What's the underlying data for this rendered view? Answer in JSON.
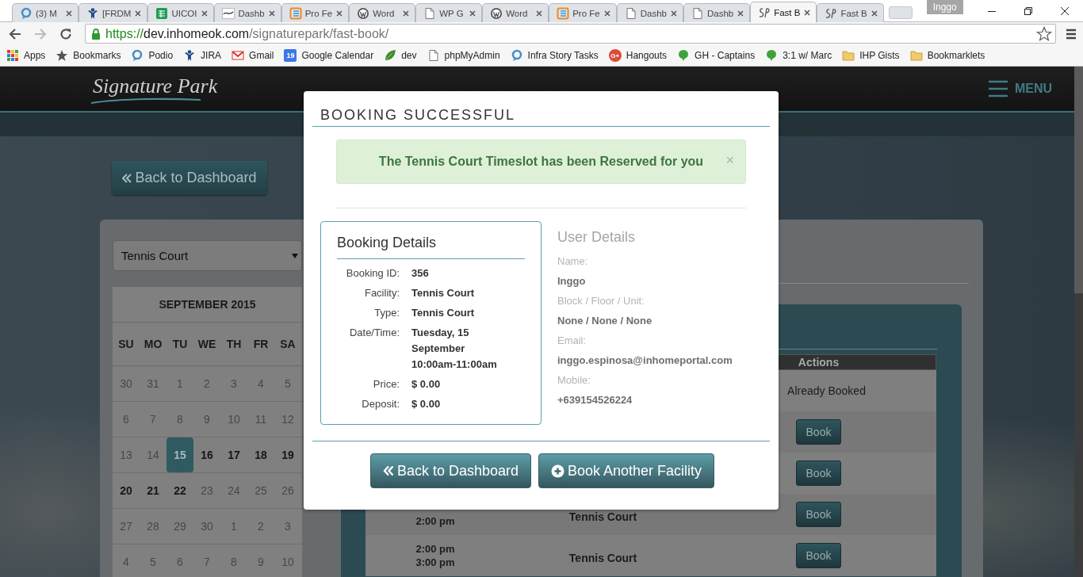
{
  "browser": {
    "tabs": [
      {
        "label": "(3) M",
        "kind": "pin",
        "selected": false
      },
      {
        "label": "[FRDM",
        "kind": "figure",
        "selected": false
      },
      {
        "label": "UICOI",
        "kind": "sheet",
        "selected": false
      },
      {
        "label": "Dashb",
        "kind": "thumb",
        "selected": false
      },
      {
        "label": "Pro Fe",
        "kind": "frame",
        "selected": false
      },
      {
        "label": "Word",
        "kind": "circle",
        "selected": false
      },
      {
        "label": "WP G",
        "kind": "page",
        "selected": false
      },
      {
        "label": "Word",
        "kind": "circle",
        "selected": false
      },
      {
        "label": "Pro Fe",
        "kind": "frame",
        "selected": false
      },
      {
        "label": "Dashb",
        "kind": "page",
        "selected": false
      },
      {
        "label": "Dashb",
        "kind": "page",
        "selected": false
      },
      {
        "label": "Fast B",
        "kind": "script",
        "selected": true
      },
      {
        "label": "Fast B",
        "kind": "script",
        "selected": false
      }
    ],
    "profile": "Inggo",
    "url": {
      "scheme": "https://",
      "host": "dev.inhomeok.com",
      "path": "/signaturepark/fast-book/"
    },
    "bookmarks": [
      {
        "label": "Apps",
        "kind": "grid"
      },
      {
        "label": "Bookmarks",
        "kind": "star"
      },
      {
        "label": "Podio",
        "kind": "pin"
      },
      {
        "label": "JIRA",
        "kind": "figure"
      },
      {
        "label": "Gmail",
        "kind": "mail"
      },
      {
        "label": "Google Calendar",
        "kind": "calendar",
        "badge": "19"
      },
      {
        "label": "dev",
        "kind": "leaf"
      },
      {
        "label": "phpMyAdmin",
        "kind": "page"
      },
      {
        "label": "Infra Story Tasks",
        "kind": "pin"
      },
      {
        "label": "Hangouts",
        "kind": "round",
        "badge": "G+"
      },
      {
        "label": "GH - Captains",
        "kind": "bubble"
      },
      {
        "label": "3:1 w/ Marc",
        "kind": "bubble"
      },
      {
        "label": "IHP Gists",
        "kind": "folder"
      },
      {
        "label": "Bookmarklets",
        "kind": "folder"
      }
    ]
  },
  "header": {
    "logo": "Signature Park",
    "menu": "MENU"
  },
  "back_button": "Back to Dashboard",
  "facility_select": {
    "value": "Tennis Court"
  },
  "calendar": {
    "title": "SEPTEMBER 2015",
    "weekdays": [
      "SU",
      "MO",
      "TU",
      "WE",
      "TH",
      "FR",
      "SA"
    ],
    "weeks": [
      [
        {
          "day": "30",
          "muted": true,
          "selected": false
        },
        {
          "day": "31",
          "muted": true,
          "selected": false
        },
        {
          "day": "1",
          "muted": true,
          "selected": false
        },
        {
          "day": "2",
          "muted": true,
          "selected": false
        },
        {
          "day": "3",
          "muted": true,
          "selected": false
        },
        {
          "day": "4",
          "muted": true,
          "selected": false
        },
        {
          "day": "5",
          "muted": true,
          "selected": false
        }
      ],
      [
        {
          "day": "6",
          "muted": true,
          "selected": false
        },
        {
          "day": "7",
          "muted": true,
          "selected": false
        },
        {
          "day": "8",
          "muted": true,
          "selected": false
        },
        {
          "day": "9",
          "muted": true,
          "selected": false
        },
        {
          "day": "10",
          "muted": true,
          "selected": false
        },
        {
          "day": "11",
          "muted": true,
          "selected": false
        },
        {
          "day": "12",
          "muted": true,
          "selected": false
        }
      ],
      [
        {
          "day": "13",
          "muted": true,
          "selected": false
        },
        {
          "day": "14",
          "muted": true,
          "selected": false
        },
        {
          "day": "15",
          "muted": false,
          "selected": true
        },
        {
          "day": "16",
          "muted": false,
          "selected": false
        },
        {
          "day": "17",
          "muted": false,
          "selected": false
        },
        {
          "day": "18",
          "muted": false,
          "selected": false
        },
        {
          "day": "19",
          "muted": false,
          "selected": false
        }
      ],
      [
        {
          "day": "20",
          "muted": false,
          "selected": false
        },
        {
          "day": "21",
          "muted": false,
          "selected": false
        },
        {
          "day": "22",
          "muted": false,
          "selected": false
        },
        {
          "day": "23",
          "muted": true,
          "selected": false
        },
        {
          "day": "24",
          "muted": true,
          "selected": false
        },
        {
          "day": "25",
          "muted": true,
          "selected": false
        },
        {
          "day": "26",
          "muted": true,
          "selected": false
        }
      ],
      [
        {
          "day": "27",
          "muted": true,
          "selected": false
        },
        {
          "day": "28",
          "muted": true,
          "selected": false
        },
        {
          "day": "29",
          "muted": true,
          "selected": false
        },
        {
          "day": "30",
          "muted": true,
          "selected": false
        },
        {
          "day": "1",
          "muted": true,
          "selected": false
        },
        {
          "day": "2",
          "muted": true,
          "selected": false
        },
        {
          "day": "3",
          "muted": true,
          "selected": false
        }
      ],
      [
        {
          "day": "4",
          "muted": true,
          "selected": false
        },
        {
          "day": "5",
          "muted": true,
          "selected": false
        },
        {
          "day": "6",
          "muted": true,
          "selected": false
        },
        {
          "day": "7",
          "muted": true,
          "selected": false
        },
        {
          "day": "8",
          "muted": true,
          "selected": false
        },
        {
          "day": "9",
          "muted": true,
          "selected": false
        },
        {
          "day": "10",
          "muted": true,
          "selected": false
        }
      ]
    ]
  },
  "table": {
    "actions_header": "Actions",
    "rows": [
      {
        "action": {
          "kind": "status",
          "label": "Already Booked"
        }
      },
      {
        "action": {
          "kind": "button",
          "label": "Book"
        }
      },
      {
        "action": {
          "kind": "button",
          "label": "Book"
        }
      },
      {
        "time": [
          "2:00 pm"
        ],
        "facility": "Tennis Court",
        "action": {
          "kind": "button",
          "label": "Book"
        }
      },
      {
        "time": [
          "2:00 pm",
          "3:00 pm"
        ],
        "facility": "Tennis Court",
        "action": {
          "kind": "button",
          "label": "Book"
        }
      }
    ]
  },
  "modal": {
    "title": "BOOKING SUCCESSFUL",
    "alert": {
      "text": "The Tennis Court Timeslot has been Reserved for you",
      "close": "×"
    },
    "booking": {
      "title": "Booking Details",
      "fields": [
        {
          "label": "Booking ID:",
          "value": "356"
        },
        {
          "label": "Facility:",
          "value": "Tennis Court"
        },
        {
          "label": "Type:",
          "value": "Tennis Court"
        },
        {
          "label": "Date/Time:",
          "value": "Tuesday, 15 September 10:00am-11:00am"
        },
        {
          "label": "Price:",
          "value": "$ 0.00"
        },
        {
          "label": "Deposit:",
          "value": "$ 0.00"
        }
      ]
    },
    "user": {
      "title": "User Details",
      "fields": [
        {
          "label": "Name:",
          "value": "Inggo"
        },
        {
          "label": "Block / Floor / Unit:",
          "value": "None / None / None"
        },
        {
          "label": "Email:",
          "value": "inggo.espinosa@inhomeportal.com"
        },
        {
          "label": "Mobile:",
          "value": "+639154526224"
        }
      ]
    },
    "buttons": [
      {
        "label": "Back to Dashboard",
        "kind": "back"
      },
      {
        "label": "Book Another Facility",
        "kind": "add"
      }
    ]
  }
}
